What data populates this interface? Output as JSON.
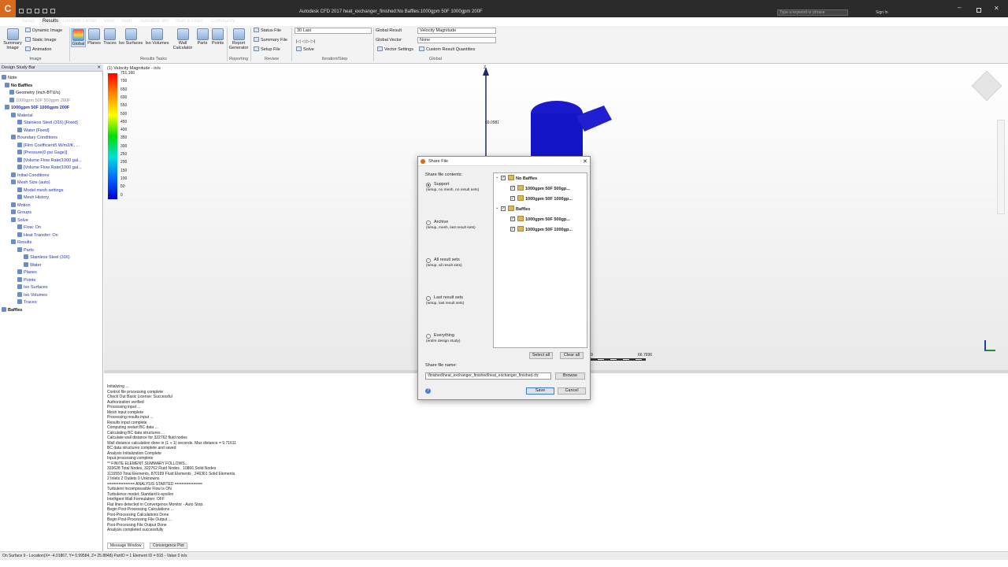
{
  "window": {
    "title": "Autodesk CFD 2017   heat_exchanger_finished:No Baffles:1000gpm 50F 1000gpm 200F",
    "search_placeholder": "Type a keyword or phrase",
    "sign_in": "Sign In"
  },
  "ribbon": {
    "tabs": [
      "Setup",
      "Results",
      "Decision Center",
      "View",
      "Vault",
      "Autodesk 360",
      "Start & Learn",
      "Community"
    ],
    "active_tab": "Results",
    "image_group": {
      "summary_image": "Summary Image",
      "dynamic_image": "Dynamic Image",
      "static_image": "Static Image",
      "animation": "Animation",
      "label": "Image"
    },
    "results_tasks": {
      "global": "Global",
      "planes": "Planes",
      "traces": "Traces",
      "iso_surfaces": "Iso Surfaces",
      "iso_volumes": "Iso Volumes",
      "wall_calculator": "Wall Calculator",
      "parts": "Parts",
      "points": "Points",
      "label": "Results Tasks"
    },
    "reporting": {
      "report_generator": "Report Generator",
      "label": "Reporting"
    },
    "review": {
      "status_file": "Status File",
      "summary_file": "Summary File",
      "setup_file": "Setup File",
      "label": "Review"
    },
    "iteration": {
      "select_value": "30 Last",
      "solve": "Solve",
      "label": "Iteration/Step"
    },
    "global": {
      "global_result_label": "Global Result",
      "global_result_value": "Velocity Magnitude",
      "global_vector_label": "Global Vector",
      "global_vector_value": "None",
      "vector_settings": "Vector Settings",
      "custom_quantities": "Custom Result Quantities",
      "label": "Global"
    }
  },
  "panel": {
    "title": "Design Study Bar",
    "items": [
      {
        "label": "Note",
        "cls": "k"
      },
      {
        "label": "No Baffles",
        "cls": "b"
      },
      {
        "label": "Geometry (inch-BTU/s)",
        "cls": "k"
      },
      {
        "label": "1000gpm 50F 500gpm 200F",
        "cls": "g"
      },
      {
        "label": "1000gpm 50F 1000gpm 200F",
        "cls": "sel2"
      },
      {
        "label": "Material",
        "cls": ""
      },
      {
        "label": "Stainless Steel (316) [Fixed]",
        "cls": ""
      },
      {
        "label": "Water [Fixed]",
        "cls": ""
      },
      {
        "label": "Boundary Conditions",
        "cls": ""
      },
      {
        "label": "[Film Coefficient5 W/m2/K, ...",
        "cls": ""
      },
      {
        "label": "[Pressure(0 psi Gage)]",
        "cls": ""
      },
      {
        "label": "[Volume Flow Rate(1000 gal...",
        "cls": ""
      },
      {
        "label": "[Volume Flow Rate(1000 gal...",
        "cls": ""
      },
      {
        "label": "Initial Conditions",
        "cls": ""
      },
      {
        "label": "Mesh Size (auto)",
        "cls": ""
      },
      {
        "label": "Model mesh settings",
        "cls": ""
      },
      {
        "label": "Mesh History",
        "cls": ""
      },
      {
        "label": "Motion",
        "cls": ""
      },
      {
        "label": "Groups",
        "cls": ""
      },
      {
        "label": "Solve",
        "cls": ""
      },
      {
        "label": "Flow: On",
        "cls": ""
      },
      {
        "label": "Heat Transfer: On",
        "cls": ""
      },
      {
        "label": "Results",
        "cls": ""
      },
      {
        "label": "Parts",
        "cls": ""
      },
      {
        "label": "Stainless Steel (316)",
        "cls": ""
      },
      {
        "label": "Water",
        "cls": ""
      },
      {
        "label": "Planes",
        "cls": ""
      },
      {
        "label": "Points",
        "cls": ""
      },
      {
        "label": "Iso Surfaces",
        "cls": ""
      },
      {
        "label": "Iso Volumes",
        "cls": ""
      },
      {
        "label": "Traces",
        "cls": ""
      },
      {
        "label": "Baffles",
        "cls": "b"
      }
    ]
  },
  "viewport": {
    "legend_title": "(1) Velocity Magnitude - in/s",
    "legend_values": [
      "751.166",
      "700",
      "650",
      "600",
      "550",
      "500",
      "450",
      "400",
      "350",
      "300",
      "250",
      "200",
      "150",
      "100",
      "50",
      "0"
    ],
    "axis_z": "Z",
    "probe_value": "69.0981",
    "ruler_end": "66.7936",
    "ruler_start": "9"
  },
  "messages": {
    "lines": [
      "Initializing ...",
      "Control file processing complete",
      "Check Out Basic License:   Successful",
      "Authorization verified",
      "Processing input ...",
      "Mesh input complete",
      "Processing results input ...",
      "Results input complete",
      "Computing restart BC data ...",
      "Calculating BC data structures ...",
      "Calculate wall distance for 322762 fluid nodes",
      "Wall distance calculation done in (1 + 1) seconds. Max distance = 9.71611",
      "BC data structures complete and saved",
      "Analysis Initialization Complete",
      "Input processing complete",
      "** FINITE ELEMENT SUMMARY FOLLOWS...",
      "333628 Total Nodes,   322762 Fluid Nodes ,   10866 Solid Nodes",
      "1116550 Total Elements,  870189 Fluid Elements ,  246361 Solid Elements",
      "2 Inlets   2 Outlets   0 Unknowns",
      "============ ANALYSIS STARTED ============",
      "Turbulent Incompressible Flow is ON",
      "Turbulence model: Standard k-epsilon",
      "Intelligent Wall Formulation: OFF",
      "Flat lines detected in Convergence Monitor - Auto Stop.",
      "Begin Post-Processing Calculations ...",
      "Post-Processing Calculations Done",
      "Begin Post-Processing File Output ...",
      "Post-Processing File Output Done",
      "Analysis completed successfully"
    ],
    "tabs": [
      "Message Window",
      "Convergence Plot"
    ]
  },
  "status": {
    "text": "On Surface 9 - Location(X= -4.01867, Y= 0.99584, Z= 25.8848) PartID = 1  Element ID = 815 - Value 0  in/s"
  },
  "dialog": {
    "title": "Share File",
    "contents_label": "Share file contents:",
    "options": [
      {
        "label": "Support",
        "desc": "(setup, no mesh, no result sets)",
        "selected": true
      },
      {
        "label": "Archive",
        "desc": "(setup, mesh, last result sets)",
        "selected": false
      },
      {
        "label": "All result sets",
        "desc": "(setup, all result sets)",
        "selected": false
      },
      {
        "label": "Last result sets",
        "desc": "(setup, last result sets)",
        "selected": false
      },
      {
        "label": "Everything",
        "desc": "(entire design study)",
        "selected": false
      }
    ],
    "tree": [
      {
        "label": "No Baffles",
        "bold": true,
        "level": 0
      },
      {
        "label": "1000gpm 50F 500gp...",
        "bold": true,
        "level": 1
      },
      {
        "label": "1000gpm 50F 1000gp...",
        "bold": true,
        "level": 1
      },
      {
        "label": "Baffles",
        "bold": true,
        "level": 0
      },
      {
        "label": "1000gpm 50F 500gp...",
        "bold": true,
        "level": 1
      },
      {
        "label": "1000gpm 50F 1000gp...",
        "bold": true,
        "level": 1
      }
    ],
    "select_all": "Select all",
    "clear_all": "Clear all",
    "file_name_label": "Share file name:",
    "file_name_value": "\\finished\\heat_exchanger_finished\\heat_exchanger_finished.cfz",
    "browse": "Browse",
    "save": "Save",
    "cancel": "Cancel"
  }
}
